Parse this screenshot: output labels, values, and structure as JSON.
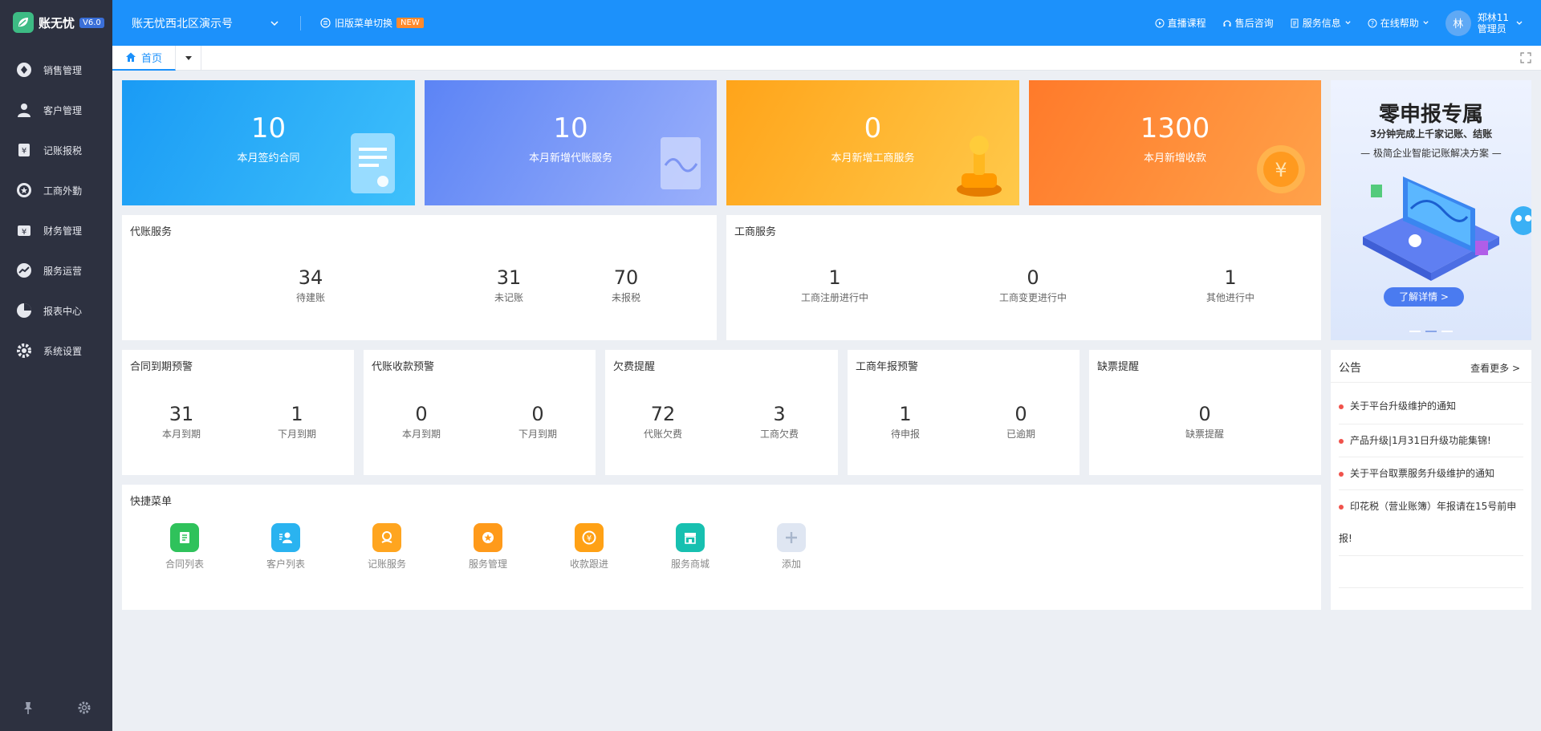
{
  "brand": {
    "name": "账无忧",
    "version": "V6.0"
  },
  "sidebar": {
    "items": [
      {
        "label": "销售管理",
        "icon": "diamond-icon"
      },
      {
        "label": "客户管理",
        "icon": "user-icon"
      },
      {
        "label": "记账报税",
        "icon": "ledger-icon"
      },
      {
        "label": "工商外勤",
        "icon": "star-circle-icon"
      },
      {
        "label": "财务管理",
        "icon": "finance-icon"
      },
      {
        "label": "服务运营",
        "icon": "trend-icon"
      },
      {
        "label": "报表中心",
        "icon": "pie-icon"
      },
      {
        "label": "系统设置",
        "icon": "gear-icon"
      }
    ]
  },
  "header": {
    "org": "账无忧西北区演示号",
    "switch_label": "旧版菜单切换",
    "new_badge": "NEW",
    "links": [
      "直播课程",
      "售后咨询",
      "服务信息",
      "在线帮助"
    ],
    "avatar_char": "林",
    "user_name": "郑林11",
    "user_role": "管理员"
  },
  "tabs": {
    "home": "首页"
  },
  "stats": [
    {
      "value": "10",
      "label": "本月签约合同",
      "color": "#1aa1f8"
    },
    {
      "value": "10",
      "label": "本月新增代账服务",
      "color": "#6b8cf6"
    },
    {
      "value": "0",
      "label": "本月新增工商服务",
      "color": "#ffab1a"
    },
    {
      "value": "1300",
      "label": "本月新增收款",
      "color": "#ff7d2a"
    }
  ],
  "daizhang": {
    "title": "代账服务",
    "metrics": [
      {
        "value": "34",
        "label": "待建账"
      },
      {
        "value": "31",
        "label": "未记账"
      },
      {
        "value": "70",
        "label": "未报税"
      }
    ]
  },
  "gongshang": {
    "title": "工商服务",
    "metrics": [
      {
        "value": "1",
        "label": "工商注册进行中"
      },
      {
        "value": "0",
        "label": "工商变更进行中"
      },
      {
        "value": "1",
        "label": "其他进行中"
      }
    ]
  },
  "alerts": [
    {
      "title": "合同到期预警",
      "metrics": [
        {
          "value": "31",
          "label": "本月到期"
        },
        {
          "value": "1",
          "label": "下月到期"
        }
      ]
    },
    {
      "title": "代账收款预警",
      "metrics": [
        {
          "value": "0",
          "label": "本月到期"
        },
        {
          "value": "0",
          "label": "下月到期"
        }
      ]
    },
    {
      "title": "欠费提醒",
      "metrics": [
        {
          "value": "72",
          "label": "代账欠费"
        },
        {
          "value": "3",
          "label": "工商欠费"
        }
      ]
    },
    {
      "title": "工商年报预警",
      "metrics": [
        {
          "value": "1",
          "label": "待申报"
        },
        {
          "value": "0",
          "label": "已逾期"
        }
      ]
    },
    {
      "title": "缺票提醒",
      "metrics": [
        {
          "value": "0",
          "label": "缺票提醒"
        }
      ]
    }
  ],
  "quick": {
    "title": "快捷菜单",
    "items": [
      {
        "label": "合同列表",
        "color": "#2fc25b"
      },
      {
        "label": "客户列表",
        "color": "#2ab3f0"
      },
      {
        "label": "记账服务",
        "color": "#ffa51f"
      },
      {
        "label": "服务管理",
        "color": "#ff9a1a"
      },
      {
        "label": "收款跟进",
        "color": "#ffa115"
      },
      {
        "label": "服务商城",
        "color": "#17c0b0"
      },
      {
        "label": "添加",
        "color": "#dfe6f2"
      }
    ]
  },
  "ad": {
    "title": "零申报专属",
    "subtitle": "3分钟完成上千家记账、结账",
    "tagline": "— 极简企业智能记账解决方案 —",
    "cta": "了解详情 >"
  },
  "notice": {
    "title": "公告",
    "more": "查看更多 >",
    "items": [
      "关于平台升级维护的通知",
      "产品升级|1月31日升级功能集锦!",
      "关于平台取票服务升级维护的通知",
      "印花税（营业账簿）年报请在15号前申",
      "报!"
    ]
  }
}
